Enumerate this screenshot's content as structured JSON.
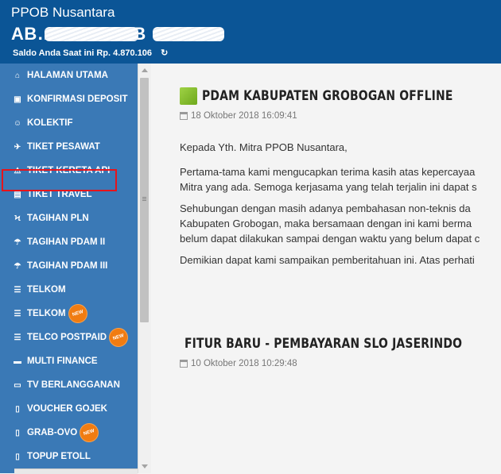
{
  "header": {
    "brand": "PPOB Nusantara",
    "account_id": "AB… - … PPOB",
    "saldo": "Saldo Anda Saat ini Rp. 4.870.106",
    "refresh_icon": "refresh-icon"
  },
  "sidebar": {
    "items": [
      {
        "label": "HALAMAN UTAMA",
        "icon": "home-icon"
      },
      {
        "label": "KONFIRMASI DEPOSIT",
        "icon": "money-icon"
      },
      {
        "label": "KOLEKTIF",
        "icon": "users-icon"
      },
      {
        "label": "TIKET PESAWAT",
        "icon": "plane-icon"
      },
      {
        "label": "TIKET KERETA API",
        "icon": "warning-icon",
        "highlighted": true
      },
      {
        "label": "TIKET TRAVEL",
        "icon": "bus-icon"
      },
      {
        "label": "TAGIHAN PLN",
        "icon": "bolt-icon"
      },
      {
        "label": "TAGIHAN PDAM II",
        "icon": "umbrella-icon"
      },
      {
        "label": "TAGIHAN PDAM III",
        "icon": "umbrella-icon"
      },
      {
        "label": "TELKOM",
        "icon": "list-icon"
      },
      {
        "label": "TELKOM",
        "icon": "list-icon",
        "badge": "NEW"
      },
      {
        "label": "TELCO POSTPAID",
        "icon": "list-icon",
        "badge": "NEW"
      },
      {
        "label": "MULTI FINANCE",
        "icon": "card-icon"
      },
      {
        "label": "TV BERLANGGANAN",
        "icon": "monitor-icon"
      },
      {
        "label": "VOUCHER GOJEK",
        "icon": "mobile-icon"
      },
      {
        "label": "GRAB-OVO",
        "icon": "mobile-icon",
        "badge": "NEW"
      },
      {
        "label": "TOPUP ETOLL",
        "icon": "mobile-icon"
      }
    ],
    "highlight_color": "#e6141b",
    "badge_color": "#f07c12"
  },
  "articles": [
    {
      "title": "PDAM KABUPATEN GROBOGAN OFFLINE",
      "date": "18 Oktober 2018 16:09:41",
      "paragraphs": [
        "Kepada Yth. Mitra PPOB Nusantara,",
        "Pertama-tama kami mengucapkan terima kasih atas kepercayaa",
        "Mitra yang ada. Semoga kerjasama yang telah terjalin ini dapat s",
        "Sehubungan dengan masih adanya pembahasan non-teknis da",
        "Kabupaten Grobogan, maka bersamaan dengan ini kami berma",
        "belum dapat dilakukan sampai dengan waktu yang belum dapat c",
        "Demikian dapat kami sampaikan pemberitahuan ini. Atas perhati"
      ]
    },
    {
      "title": "FITUR BARU - PEMBAYARAN SLO JASERINDO",
      "date": "10 Oktober 2018 10:29:48"
    }
  ],
  "colors": {
    "header_bg": "#0b5596",
    "sidebar_bg": "#3a79b6",
    "accent_green": "#7cb82a"
  }
}
